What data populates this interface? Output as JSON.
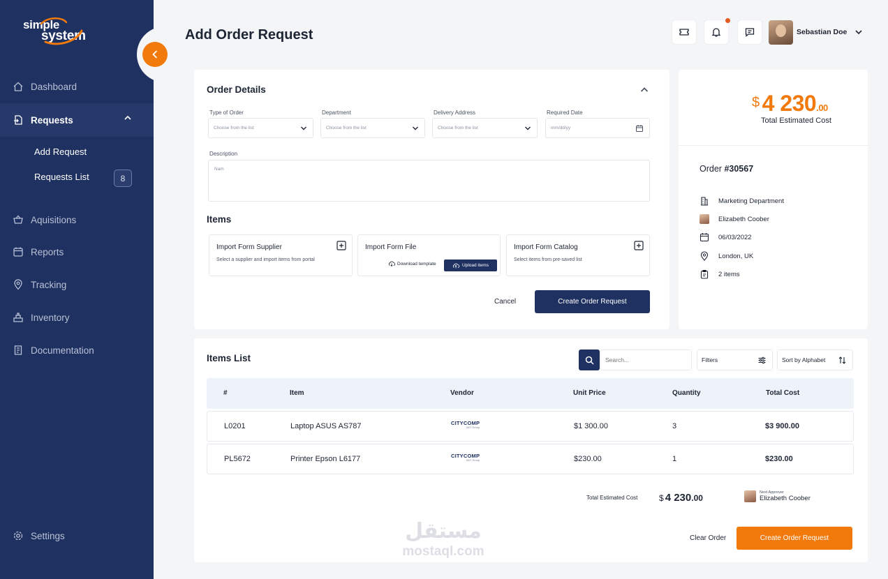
{
  "brand": {
    "line1": "simple",
    "line2": "system",
    "accent": "#f27a0d",
    "navy": "#1f3160"
  },
  "sidebar": {
    "items": [
      {
        "label": "Dashboard",
        "icon": "home-icon"
      },
      {
        "label": "Requests",
        "icon": "requests-icon"
      },
      {
        "label": "Aquisitions",
        "icon": "basket-icon"
      },
      {
        "label": "Reports",
        "icon": "calendar-icon"
      },
      {
        "label": "Tracking",
        "icon": "location-icon"
      },
      {
        "label": "Inventory",
        "icon": "inventory-icon"
      },
      {
        "label": "Documentation",
        "icon": "document-icon"
      },
      {
        "label": "Settings",
        "icon": "gear-icon"
      }
    ],
    "sub_items": [
      {
        "label": "Add Request"
      },
      {
        "label": "Requests List",
        "badge": "8"
      }
    ]
  },
  "header": {
    "title": "Add Order Request",
    "user_name": "Sebastian Doe"
  },
  "order_details": {
    "title": "Order Details",
    "fields": [
      {
        "label": "Type of Order",
        "placeholder": "Choose from the list"
      },
      {
        "label": "Department",
        "placeholder": "Choose from the list"
      },
      {
        "label": "Delivery Address",
        "placeholder": "Choose from the list"
      },
      {
        "label": "Required Date",
        "placeholder": "mm/dd/yy"
      }
    ],
    "description_label": "Description",
    "description_placeholder": "Nam",
    "items_title": "Items",
    "import_cards": [
      {
        "title": "Import Form Supplier",
        "subtitle": "Select a supplier and import items from portal"
      },
      {
        "title": "Import Form File",
        "download_label": "Download template",
        "upload_label": "Upload items"
      },
      {
        "title": "Import Form Catalog",
        "subtitle": "Select items from pre-saved list"
      }
    ],
    "cancel_label": "Cancel",
    "create_label": "Create Order Request"
  },
  "summary": {
    "currency": "$",
    "amount": "4 230",
    "decimals": ".00",
    "cost_label": "Total Estimated Cost",
    "order_prefix": "Order",
    "order_number": "#30567",
    "department": "Marketing Department",
    "person": "Elizabeth Coober",
    "date": "06/03/2022",
    "location": "London, UK",
    "items": "2 items"
  },
  "items_list": {
    "title": "Items List",
    "search_placeholder": "Search...",
    "filters_label": "Filters",
    "sort_label": "Sort by Alphabet",
    "columns": [
      "#",
      "Item",
      "Vendor",
      "Unit Price",
      "Quantity",
      "Total Cost"
    ],
    "rows": [
      {
        "id": "L0201",
        "item": "Laptop ASUS AS787",
        "vendor": "CITYCOMP",
        "vendor_sub": "S&T Group",
        "unit_price": "$1 300.00",
        "quantity": "3",
        "total": "$3 900.00"
      },
      {
        "id": "PL5672",
        "item": "Printer Epson L6177",
        "vendor": "CITYCOMP",
        "vendor_sub": "S&T Group",
        "unit_price": "$230.00",
        "quantity": "1",
        "total": "$230.00"
      }
    ],
    "total_label": "Total Estimated Cost",
    "total_currency": "$",
    "total_amount": "4 230",
    "total_decimals": ".00",
    "approver_label": "Next Approver",
    "approver_name": "Elizabeth Coober",
    "clear_label": "Clear Order",
    "create_label": "Create Order Request"
  },
  "watermark": {
    "arabic": "مستقل",
    "latin": "mostaql.com"
  }
}
